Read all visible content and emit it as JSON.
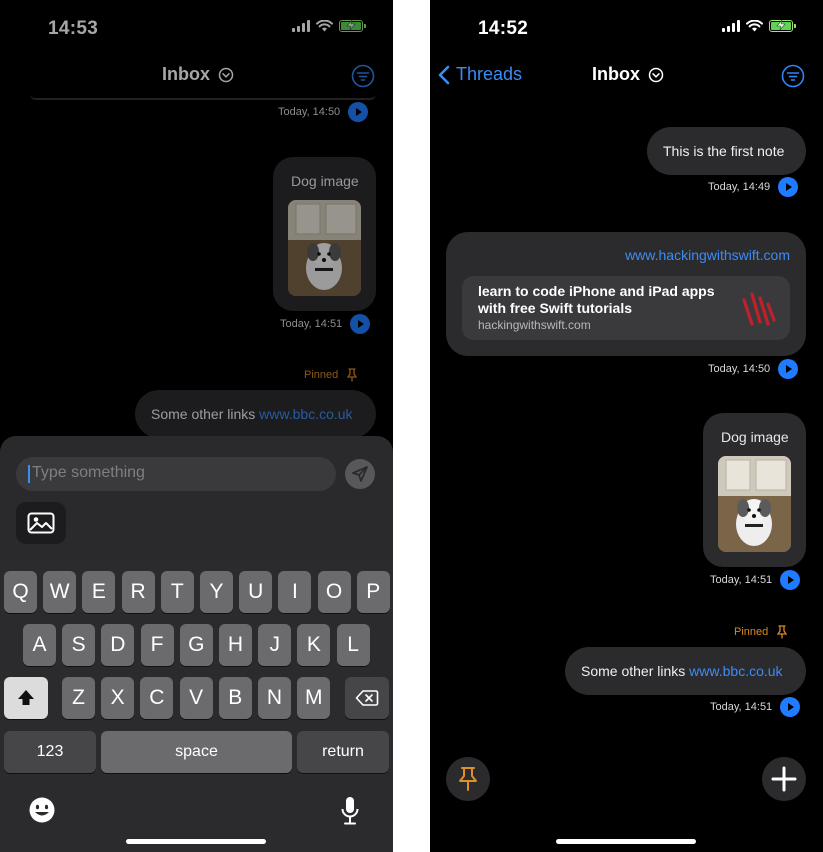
{
  "left": {
    "status_time": "14:53",
    "nav_title": "Inbox",
    "timestamp_top": "Today, 14:50",
    "dog_bubble_label": "Dog image",
    "dog_timestamp": "Today, 14:51",
    "pinned_label": "Pinned",
    "links_bubble_text": "Some other links",
    "links_bubble_link": "www.bbc.co.uk",
    "input_placeholder": "Type something",
    "keyboard": {
      "row1": [
        "Q",
        "W",
        "E",
        "R",
        "T",
        "Y",
        "U",
        "I",
        "O",
        "P"
      ],
      "row2": [
        "A",
        "S",
        "D",
        "F",
        "G",
        "H",
        "J",
        "K",
        "L"
      ],
      "row3": [
        "Z",
        "X",
        "C",
        "V",
        "B",
        "N",
        "M"
      ],
      "numbers_key": "123",
      "space_key": "space",
      "return_key": "return"
    }
  },
  "right": {
    "status_time": "14:52",
    "back_label": "Threads",
    "nav_title": "Inbox",
    "note_text": "This is the first note",
    "note_timestamp": "Today, 14:49",
    "link_bubble_url": "www.hackingwithswift.com",
    "link_card_title": "learn to code iPhone and iPad apps with free Swift tutorials",
    "link_card_domain": "hackingwithswift.com",
    "link_timestamp": "Today, 14:50",
    "dog_bubble_label": "Dog image",
    "dog_timestamp": "Today, 14:51",
    "pinned_label": "Pinned",
    "links_bubble_text": "Some other links",
    "links_bubble_link": "www.bbc.co.uk",
    "links_timestamp": "Today, 14:51"
  },
  "colors": {
    "accent": "#1f7bff",
    "link": "#3d8cf5",
    "pinned": "#d88a20",
    "bubble": "#2b2b2e",
    "background": "#000000"
  },
  "icons": [
    "chevron-circle-icon",
    "filter-icon",
    "send-arrow-icon",
    "image-icon",
    "pin-icon",
    "plus-icon",
    "shift-icon",
    "delete-icon",
    "emoji-icon",
    "mic-icon",
    "back-chevron-icon"
  ]
}
